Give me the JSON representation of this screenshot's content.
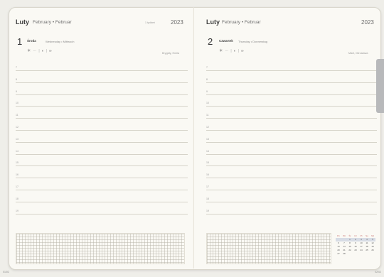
{
  "left": {
    "month": "Luty",
    "month_sub": "February • Februar",
    "week_label": "1 tydzień",
    "year": "2023",
    "day": "1",
    "weekday": "Środa",
    "weekday_sub": "Wednesday • Mittwoch",
    "namedays": "Brygidy, Emila",
    "hours": [
      "7",
      "8",
      "9",
      "10",
      "11",
      "12",
      "13",
      "14",
      "15",
      "16",
      "17",
      "18",
      "19"
    ]
  },
  "right": {
    "month": "Luty",
    "month_sub": "February • Februar",
    "year": "2023",
    "day": "2",
    "weekday": "Czwartek",
    "weekday_sub": "Thursday • Donnerstag",
    "namedays": "Marii, Mirosława",
    "hours": [
      "7",
      "8",
      "9",
      "10",
      "11",
      "12",
      "13",
      "14",
      "15",
      "16",
      "17",
      "18",
      "19"
    ]
  },
  "icons": [
    "sun-icon",
    "sunrise-sunset-icon",
    "moon-icon",
    "infinity-icon"
  ],
  "mini_calendar": {
    "headers": [
      "Pn",
      "Wt",
      "Śr",
      "Cz",
      "Pt",
      "So",
      "Nd"
    ],
    "rows": [
      [
        "",
        "",
        "1",
        "2",
        "3",
        "4",
        "5"
      ],
      [
        "6",
        "7",
        "8",
        "9",
        "10",
        "11",
        "12"
      ],
      [
        "13",
        "14",
        "15",
        "16",
        "17",
        "18",
        "19"
      ],
      [
        "20",
        "21",
        "22",
        "23",
        "24",
        "25",
        "26"
      ],
      [
        "27",
        "28",
        "",
        "",
        "",
        "",
        ""
      ]
    ]
  },
  "footer": {
    "left": "01/02",
    "right": "02/02"
  },
  "colors": {
    "paper": "#faf9f4",
    "line": "#d6d3c9",
    "tab": "#b8b9bb",
    "header_accent": "#c9716f"
  }
}
